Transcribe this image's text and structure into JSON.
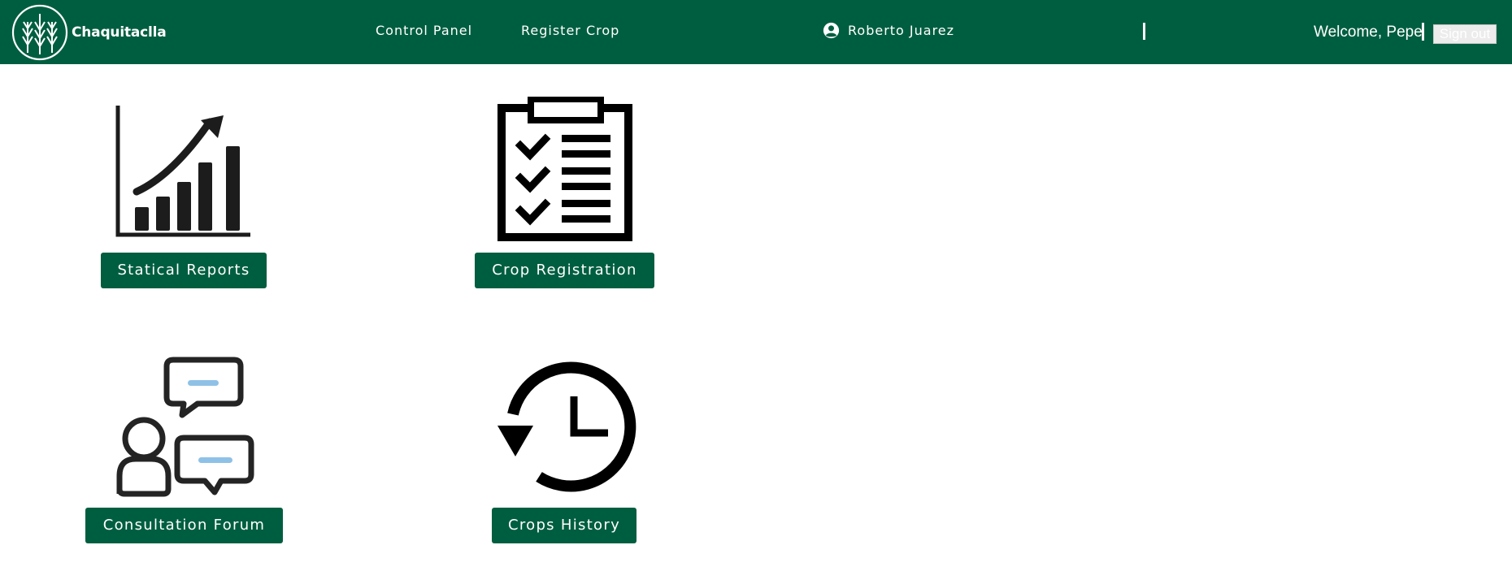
{
  "header": {
    "brand": "Chaquitaclla",
    "nav": [
      "Control Panel",
      "Register Crop"
    ],
    "user_name": "Roberto Juarez",
    "welcome": "Welcome, Pepe",
    "sign_out": "Sign out"
  },
  "cards": [
    {
      "label": "Statical Reports",
      "icon": "bar-chart-trend-icon"
    },
    {
      "label": "Crop Registration",
      "icon": "clipboard-checklist-icon"
    },
    {
      "label": "Consultation Forum",
      "icon": "forum-chat-icon"
    },
    {
      "label": "Crops History",
      "icon": "history-clock-icon"
    }
  ],
  "colors": {
    "brand": "#005e40",
    "text_on_brand": "#ffffff",
    "chat_accent": "#8fc1e6"
  }
}
